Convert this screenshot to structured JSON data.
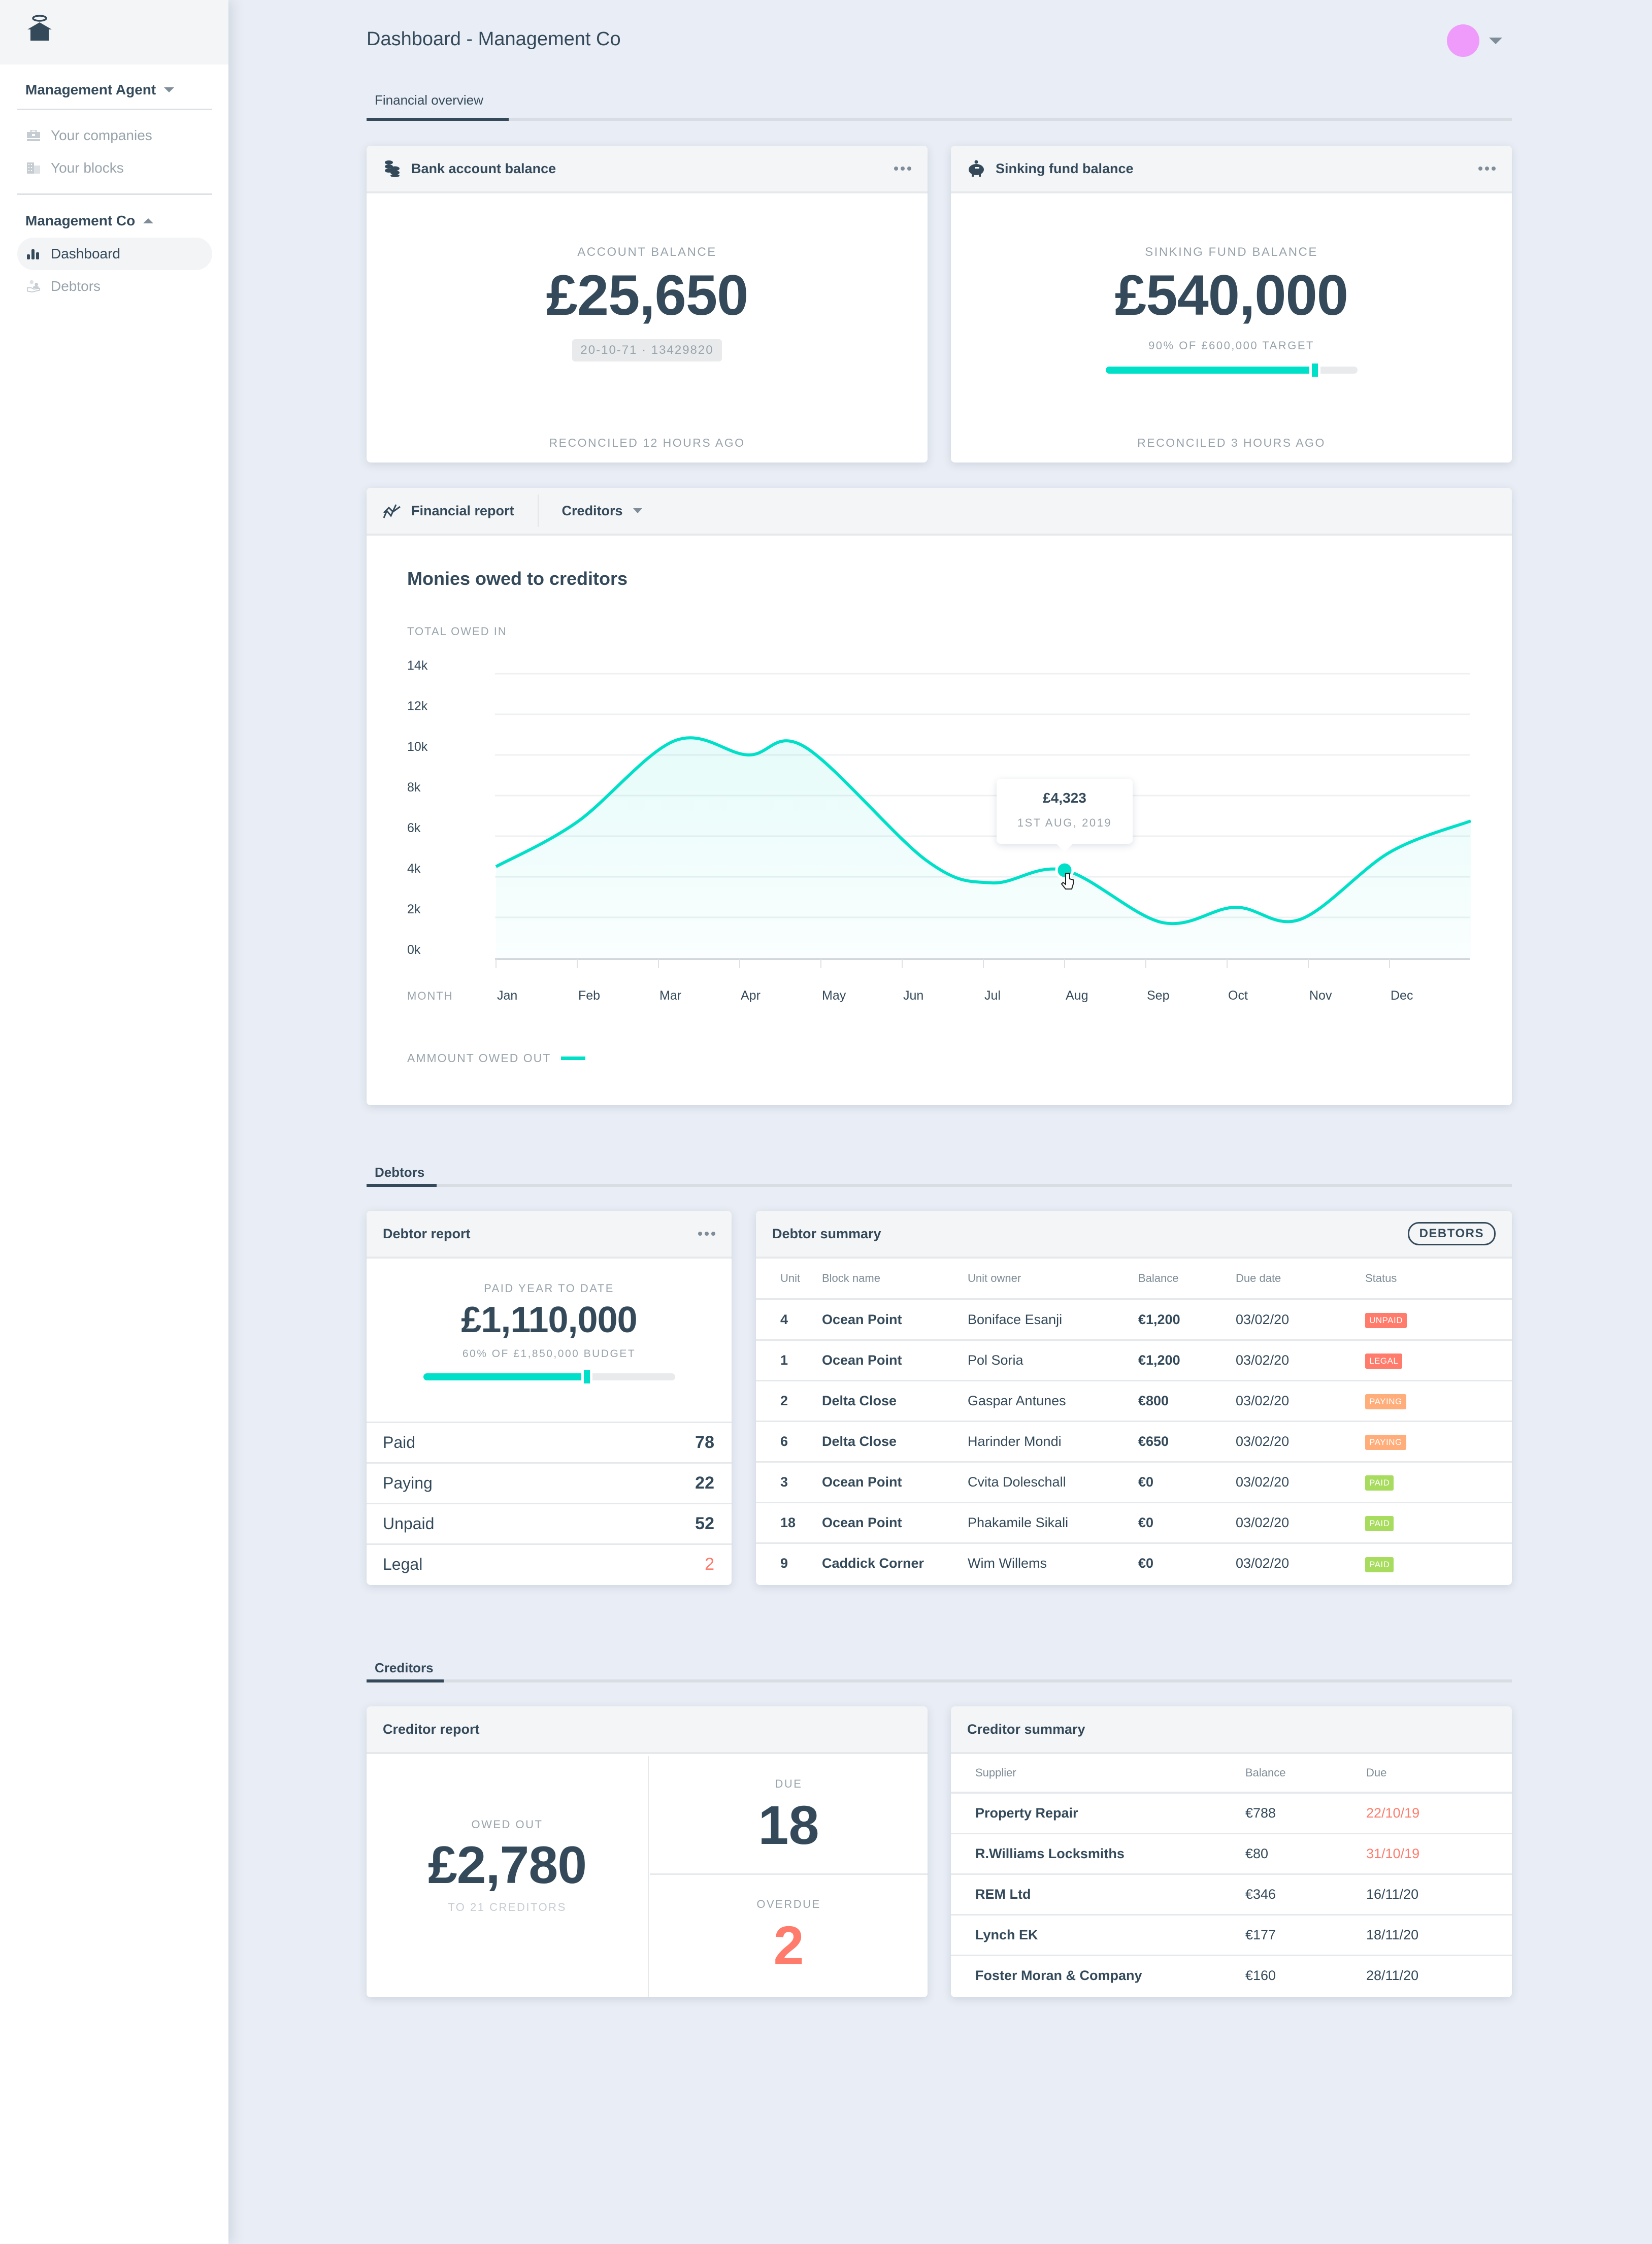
{
  "sidebar": {
    "logo": "halo-house-logo",
    "agent_menu": {
      "label": "Management Agent",
      "items": [
        {
          "label": "Your companies",
          "icon": "briefcase-icon"
        },
        {
          "label": "Your blocks",
          "icon": "building-icon"
        }
      ]
    },
    "company_menu": {
      "label": "Management Co",
      "items": [
        {
          "label": "Dashboard",
          "icon": "bar-chart-icon",
          "active": true
        },
        {
          "label": "Debtors",
          "icon": "hand-people-icon",
          "active": false
        }
      ]
    }
  },
  "header": {
    "title": "Dashboard - Management Co",
    "avatar_color": "#ef9bfb"
  },
  "sections": {
    "financial": "Financial overview",
    "debtors": "Debtors",
    "creditors": "Creditors"
  },
  "bank_card": {
    "title": "Bank account balance",
    "label": "ACCOUNT BALANCE",
    "value": "£25,650",
    "account": "20-10-71  ·  13429820",
    "footer": "RECONCILED 12 HOURS AGO"
  },
  "sinking_card": {
    "title": "Sinking fund balance",
    "label": "SINKING FUND BALANCE",
    "value": "£540,000",
    "target_text": "90% OF £600,000 TARGET",
    "progress": 0.82,
    "footer": "RECONCILED 3 HOURS AGO"
  },
  "financial_report": {
    "title": "Financial report",
    "dropdown": "Creditors",
    "chart_title": "Monies owed to creditors",
    "y_label": "TOTAL OWED IN",
    "x_label": "MONTH",
    "legend": "AMMOUNT OWED OUT",
    "tooltip": {
      "value": "£4,323",
      "date": "1ST AUG, 2019"
    }
  },
  "chart_data": {
    "type": "area",
    "title": "Monies owed to creditors",
    "ylabel": "TOTAL OWED IN",
    "xlabel": "MONTH",
    "categories": [
      "Jan",
      "Feb",
      "Mar",
      "Apr",
      "May",
      "Jun",
      "Jul",
      "Aug",
      "Sep",
      "Oct",
      "Nov",
      "Dec"
    ],
    "yticks": [
      "0k",
      "2k",
      "4k",
      "6k",
      "8k",
      "10k",
      "12k",
      "14k"
    ],
    "ylim": [
      0,
      14000
    ],
    "grid": true,
    "legend_position": "bottom-left",
    "series": [
      {
        "name": "AMMOUNT OWED OUT",
        "color": "#00e0c8",
        "points": [
          {
            "x": 0,
            "y": 4500
          },
          {
            "x": 1,
            "y": 6700
          },
          {
            "x": 2.2,
            "y": 10700
          },
          {
            "x": 3.1,
            "y": 10000
          },
          {
            "x": 3.8,
            "y": 10400
          },
          {
            "x": 5.3,
            "y": 4800
          },
          {
            "x": 6.1,
            "y": 3700
          },
          {
            "x": 7,
            "y": 4323
          },
          {
            "x": 8.2,
            "y": 1750
          },
          {
            "x": 9.1,
            "y": 2500
          },
          {
            "x": 9.9,
            "y": 1900
          },
          {
            "x": 11.0,
            "y": 5200
          },
          {
            "x": 12,
            "y": 6750
          }
        ]
      }
    ],
    "highlight": {
      "x": 7,
      "y": 4323,
      "label": "£4,323",
      "date": "1ST AUG, 2019"
    }
  },
  "debtor_report": {
    "title": "Debtor report",
    "label": "PAID YEAR TO DATE",
    "value": "£1,110,000",
    "budget_text": "60% OF £1,850,000 BUDGET",
    "progress": 0.64,
    "rows": [
      {
        "label": "Paid",
        "value": "78"
      },
      {
        "label": "Paying",
        "value": "22"
      },
      {
        "label": "Unpaid",
        "value": "52"
      },
      {
        "label": "Legal",
        "value": "2",
        "alert": true
      }
    ]
  },
  "debtor_summary": {
    "title": "Debtor summary",
    "button": "DEBTORS",
    "columns": [
      "Unit",
      "Block name",
      "Unit owner",
      "Balance",
      "Due date",
      "Status"
    ],
    "status_colors": {
      "UNPAID": "#ff7b6b",
      "LEGAL": "#ff7b6b",
      "PAYING": "#ffad7a",
      "PAID": "#a8dc5f"
    },
    "rows": [
      {
        "unit": "4",
        "block": "Ocean Point",
        "owner": "Boniface Esanji",
        "balance": "€1,200",
        "due": "03/02/20",
        "status": "UNPAID"
      },
      {
        "unit": "1",
        "block": "Ocean Point",
        "owner": "Pol Soria",
        "balance": "€1,200",
        "due": "03/02/20",
        "status": "LEGAL"
      },
      {
        "unit": "2",
        "block": "Delta Close",
        "owner": "Gaspar Antunes",
        "balance": "€800",
        "due": "03/02/20",
        "status": "PAYING"
      },
      {
        "unit": "6",
        "block": "Delta Close",
        "owner": "Harinder Mondi",
        "balance": "€650",
        "due": "03/02/20",
        "status": "PAYING"
      },
      {
        "unit": "3",
        "block": "Ocean Point",
        "owner": "Cvita Doleschall",
        "balance": "€0",
        "due": "03/02/20",
        "status": "PAID"
      },
      {
        "unit": "18",
        "block": "Ocean Point",
        "owner": "Phakamile Sikali",
        "balance": "€0",
        "due": "03/02/20",
        "status": "PAID"
      },
      {
        "unit": "9",
        "block": "Caddick Corner",
        "owner": "Wim Willems",
        "balance": "€0",
        "due": "03/02/20",
        "status": "PAID"
      }
    ]
  },
  "creditor_report": {
    "title": "Creditor report",
    "owed_label": "OWED OUT",
    "owed_value": "£2,780",
    "owed_sub": "TO 21 CREDITORS",
    "due_label": "DUE",
    "due_value": "18",
    "overdue_label": "OVERDUE",
    "overdue_value": "2"
  },
  "creditor_summary": {
    "title": "Creditor summary",
    "columns": [
      "Supplier",
      "Balance",
      "Due"
    ],
    "rows": [
      {
        "supplier": "Property Repair",
        "balance": "€788",
        "due": "22/10/19",
        "overdue": true
      },
      {
        "supplier": "R.Williams Locksmiths",
        "balance": "€80",
        "due": "31/10/19",
        "overdue": true
      },
      {
        "supplier": "REM Ltd",
        "balance": "€346",
        "due": "16/11/20",
        "overdue": false
      },
      {
        "supplier": "Lynch EK",
        "balance": "€177",
        "due": "18/11/20",
        "overdue": false
      },
      {
        "supplier": "Foster Moran & Company",
        "balance": "€160",
        "due": "28/11/20",
        "overdue": false
      }
    ]
  }
}
